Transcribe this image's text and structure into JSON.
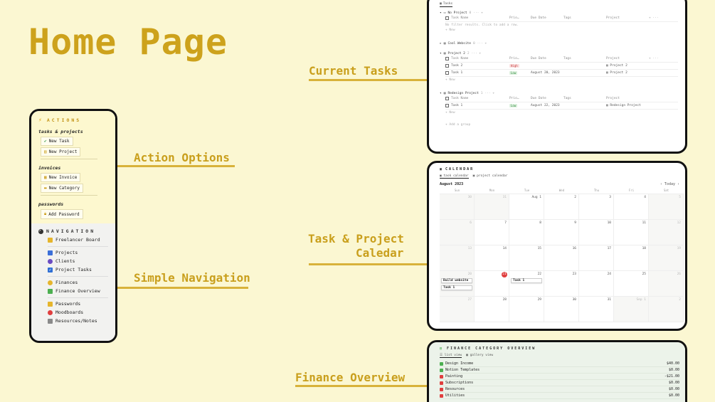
{
  "title": "Home Page",
  "callouts": {
    "current_tasks": "Current Tasks",
    "action_options": "Action Options",
    "task_project_line1": "Task & Project",
    "task_project_line2": "Caledar",
    "simple_navigation": "Simple Navigation",
    "finance_overview": "Finance Overview"
  },
  "actions": {
    "header": "ACTIONS",
    "groups": [
      {
        "label": "tasks & projects",
        "items": [
          "New Task",
          "New Project"
        ]
      },
      {
        "label": "invoices",
        "items": [
          "New Invoice",
          "New Category"
        ]
      },
      {
        "label": "passwords",
        "items": [
          "Add Password"
        ]
      }
    ]
  },
  "navigation": {
    "header": "NAVIGATION",
    "items": [
      "Freelancer Board",
      "Projects",
      "Clients",
      "Project Tasks",
      "Finances",
      "Finance Overview",
      "Passwords",
      "Moodboards",
      "Resources/Notes"
    ]
  },
  "tasks_panel": {
    "tab": "Tasks",
    "columns": [
      "Task Name",
      "Prio…",
      "Due Date",
      "Tags",
      "Project"
    ],
    "no_project": {
      "label": "No Project",
      "count": "0",
      "empty": "No filter results. Click to add a row.",
      "new": "+ New"
    },
    "cool_website": {
      "label": "Cool Website",
      "count": "0"
    },
    "project2": {
      "label": "Project 2",
      "count": "2",
      "rows": [
        {
          "name": "Task 2",
          "prio": "High",
          "due": "",
          "project": "Project 2"
        },
        {
          "name": "Task 1",
          "prio": "Low",
          "due": "August 20, 2023",
          "project": "Project 2"
        }
      ],
      "new": "+ New"
    },
    "redesign": {
      "label": "Redesign Project",
      "count": "1",
      "rows": [
        {
          "name": "Task 1",
          "prio": "Low",
          "due": "August 22, 2023",
          "project": "Redesign Project"
        }
      ],
      "new": "+ New"
    },
    "add_group": "+ Add a group"
  },
  "calendar_panel": {
    "header": "CALENDAR",
    "tabs": [
      "task calendar",
      "project calendar"
    ],
    "month": "August 2023",
    "today_label": "Today",
    "dows": [
      "Sun",
      "Mon",
      "Tue",
      "Wed",
      "Thu",
      "Fri",
      "Sat"
    ],
    "days": [
      "30",
      "31",
      "Aug 1",
      "2",
      "3",
      "4",
      "5",
      "6",
      "7",
      "8",
      "9",
      "10",
      "11",
      "12",
      "13",
      "14",
      "15",
      "16",
      "17",
      "18",
      "19",
      "20",
      "21",
      "22",
      "23",
      "24",
      "25",
      "26",
      "27",
      "28",
      "29",
      "30",
      "31",
      "Sep 1",
      "2"
    ],
    "events": {
      "build": "Build website",
      "task1a": "Task 1",
      "task1b": "Task 1"
    }
  },
  "finance_panel": {
    "header": "FINANCE CATEGORY OVERVIEW",
    "tabs": [
      "list view",
      "gallery view"
    ],
    "rows": [
      {
        "name": "Design Income",
        "value": "$40.00",
        "color": "#4caf50"
      },
      {
        "name": "Notion Templates",
        "value": "$0.00",
        "color": "#4caf50"
      },
      {
        "name": "Painting",
        "value": "-$21.00",
        "color": "#e03e3e"
      },
      {
        "name": "Subscriptions",
        "value": "$0.00",
        "color": "#e03e3e"
      },
      {
        "name": "Resources",
        "value": "$0.00",
        "color": "#e03e3e"
      },
      {
        "name": "Utilities",
        "value": "$0.00",
        "color": "#e03e3e"
      }
    ]
  },
  "colors": {
    "accent": "#cda21c",
    "background": "#fbf7d2"
  }
}
